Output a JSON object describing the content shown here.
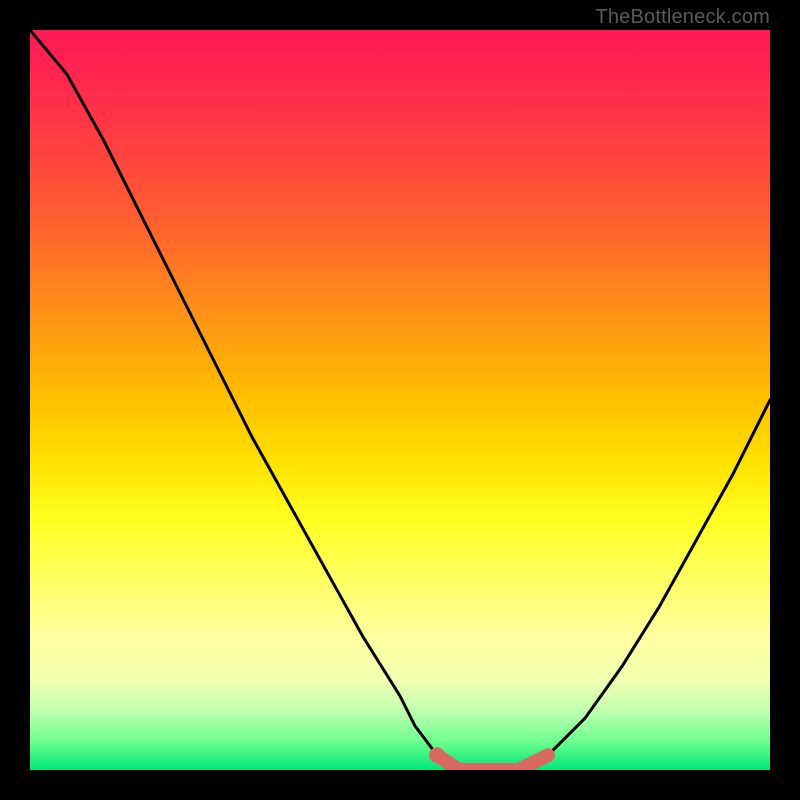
{
  "watermark": "TheBottleneck.com",
  "chart_data": {
    "type": "line",
    "title": "",
    "xlabel": "",
    "ylabel": "",
    "xlim": [
      0,
      100
    ],
    "ylim": [
      0,
      100
    ],
    "series": [
      {
        "name": "bottleneck-curve",
        "x": [
          0,
          5,
          10,
          15,
          20,
          25,
          30,
          35,
          40,
          45,
          50,
          52,
          55,
          58,
          62,
          66,
          70,
          75,
          80,
          85,
          90,
          95,
          100
        ],
        "y": [
          100,
          94,
          85,
          75,
          65,
          55,
          45,
          36,
          27,
          18,
          10,
          6,
          2,
          0,
          0,
          0,
          2,
          7,
          14,
          22,
          31,
          40,
          50
        ]
      }
    ],
    "highlight": {
      "name": "optimal-range",
      "x": [
        55,
        58,
        62,
        66,
        70
      ],
      "y": [
        2,
        0,
        0,
        0,
        2
      ],
      "color": "#d86a62"
    },
    "highlight_point": {
      "x": 55,
      "y": 2,
      "color": "#d86a62"
    },
    "gradient_stops": [
      {
        "pct": 0,
        "color": "#ff1a55"
      },
      {
        "pct": 50,
        "color": "#ffc000"
      },
      {
        "pct": 75,
        "color": "#ffff60"
      },
      {
        "pct": 100,
        "color": "#00e878"
      }
    ]
  }
}
